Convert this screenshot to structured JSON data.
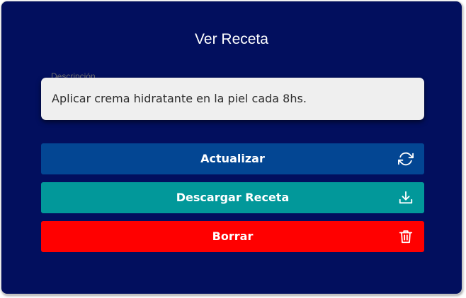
{
  "dialog": {
    "title": "Ver Receta",
    "background_color": "#020f5e"
  },
  "description_field": {
    "label": "Descripción",
    "value": "Aplicar crema hidratante en la piel cada 8hs."
  },
  "buttons": {
    "update": {
      "label": "Actualizar",
      "icon": "refresh-icon",
      "color": "#034693"
    },
    "download": {
      "label": "Descargar Receta",
      "icon": "download-icon",
      "color": "#02989a"
    },
    "delete": {
      "label": "Borrar",
      "icon": "trash-icon",
      "color": "#ff0000"
    }
  }
}
